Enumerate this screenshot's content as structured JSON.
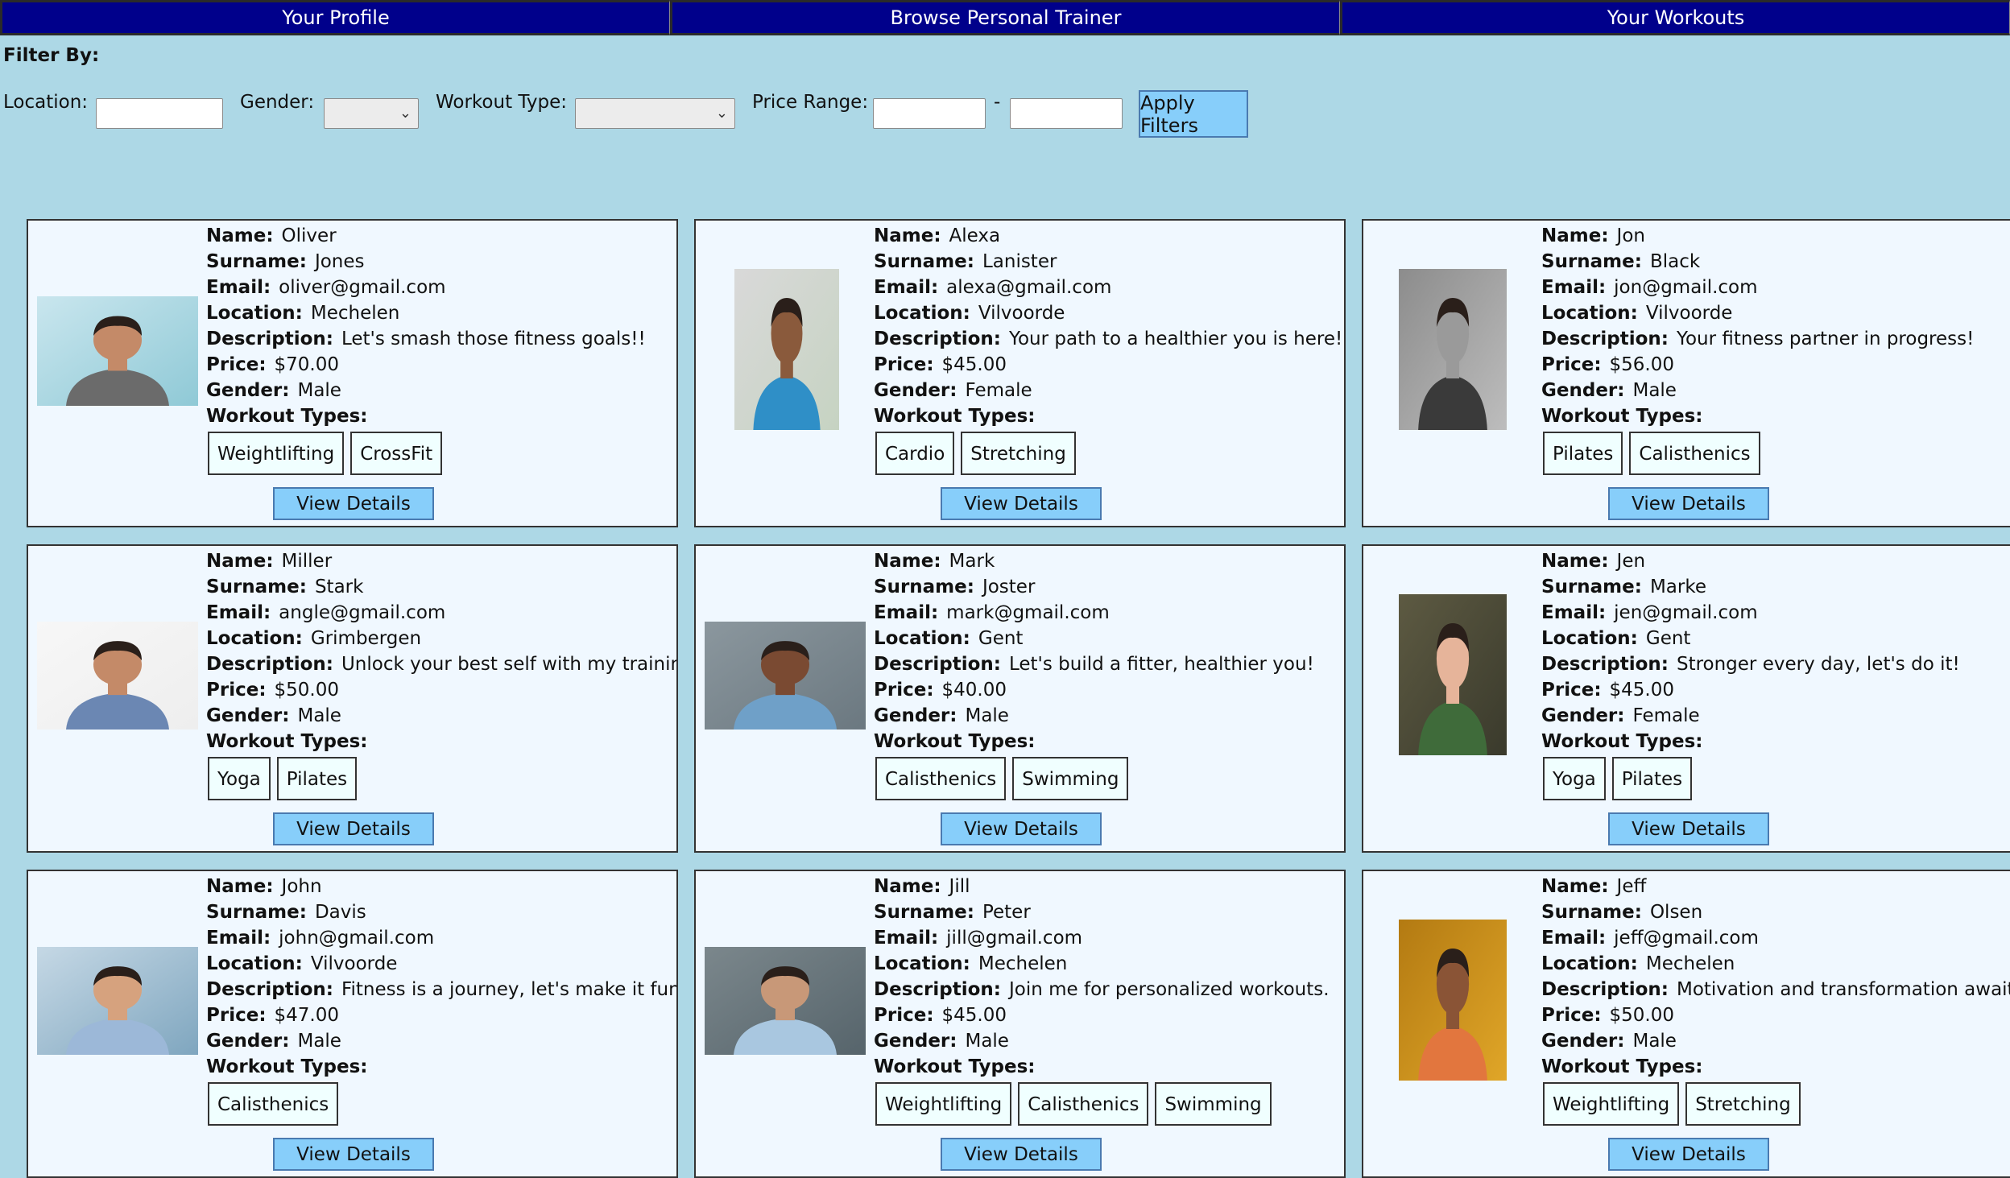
{
  "nav": {
    "profile": "Your Profile",
    "browse": "Browse Personal Trainer",
    "workouts": "Your Workouts"
  },
  "filters": {
    "title": "Filter By:",
    "location_label": "Location:",
    "gender_label": "Gender:",
    "workout_type_label": "Workout Type:",
    "price_range_label": "Price Range:",
    "range_dash": "-",
    "apply_label": "Apply Filters",
    "location_value": "",
    "price_min_value": "",
    "price_max_value": ""
  },
  "labels": {
    "name": "Name:",
    "surname": "Surname:",
    "email": "Email:",
    "location": "Location:",
    "description": "Description:",
    "price": "Price:",
    "gender": "Gender:",
    "workout_types": "Workout Types:",
    "view_details": "View Details"
  },
  "colors": {
    "background": "#add8e6",
    "nav": "#00008b",
    "card": "#f0f8ff",
    "button": "#87cefa"
  },
  "trainers": [
    {
      "name": "Oliver",
      "surname": "Jones",
      "email": "oliver@gmail.com",
      "location": "Mechelen",
      "description": "Let's smash those fitness goals!!",
      "price": "$70.00",
      "gender": "Male",
      "workout_types": [
        "Weightlifting",
        "CrossFit"
      ],
      "photo": "trainer-photo"
    },
    {
      "name": "Alexa",
      "surname": "Lanister",
      "email": "alexa@gmail.com",
      "location": "Vilvoorde",
      "description": "Your path to a healthier you is here!",
      "price": "$45.00",
      "gender": "Female",
      "workout_types": [
        "Cardio",
        "Stretching"
      ],
      "photo": "trainer-photo"
    },
    {
      "name": "Jon",
      "surname": "Black",
      "email": "jon@gmail.com",
      "location": "Vilvoorde",
      "description": "Your fitness partner in progress!",
      "price": "$56.00",
      "gender": "Male",
      "workout_types": [
        "Pilates",
        "Calisthenics"
      ],
      "photo": "trainer-photo"
    },
    {
      "name": "Miller",
      "surname": "Stark",
      "email": "angle@gmail.com",
      "location": "Grimbergen",
      "description": "Unlock your best self with my training!",
      "price": "$50.00",
      "gender": "Male",
      "workout_types": [
        "Yoga",
        "Pilates"
      ],
      "photo": "trainer-photo"
    },
    {
      "name": "Mark",
      "surname": "Joster",
      "email": "mark@gmail.com",
      "location": "Gent",
      "description": "Let's build a fitter, healthier you!",
      "price": "$40.00",
      "gender": "Male",
      "workout_types": [
        "Calisthenics",
        "Swimming"
      ],
      "photo": "trainer-photo"
    },
    {
      "name": "Jen",
      "surname": "Marke",
      "email": "jen@gmail.com",
      "location": "Gent",
      "description": "Stronger every day, let's do it!",
      "price": "$45.00",
      "gender": "Female",
      "workout_types": [
        "Yoga",
        "Pilates"
      ],
      "photo": "trainer-photo"
    },
    {
      "name": "John",
      "surname": "Davis",
      "email": "john@gmail.com",
      "location": "Vilvoorde",
      "description": "Fitness is a journey, let's make it fun!",
      "price": "$47.00",
      "gender": "Male",
      "workout_types": [
        "Calisthenics"
      ],
      "photo": "trainer-photo"
    },
    {
      "name": "Jill",
      "surname": "Peter",
      "email": "jill@gmail.com",
      "location": "Mechelen",
      "description": "Join me for personalized workouts.",
      "price": "$45.00",
      "gender": "Male",
      "workout_types": [
        "Weightlifting",
        "Calisthenics",
        "Swimming"
      ],
      "photo": "trainer-photo"
    },
    {
      "name": "Jeff",
      "surname": "Olsen",
      "email": "jeff@gmail.com",
      "location": "Mechelen",
      "description": "Motivation and transformation await you",
      "price": "$50.00",
      "gender": "Male",
      "workout_types": [
        "Weightlifting",
        "Stretching"
      ],
      "photo": "trainer-photo"
    }
  ]
}
